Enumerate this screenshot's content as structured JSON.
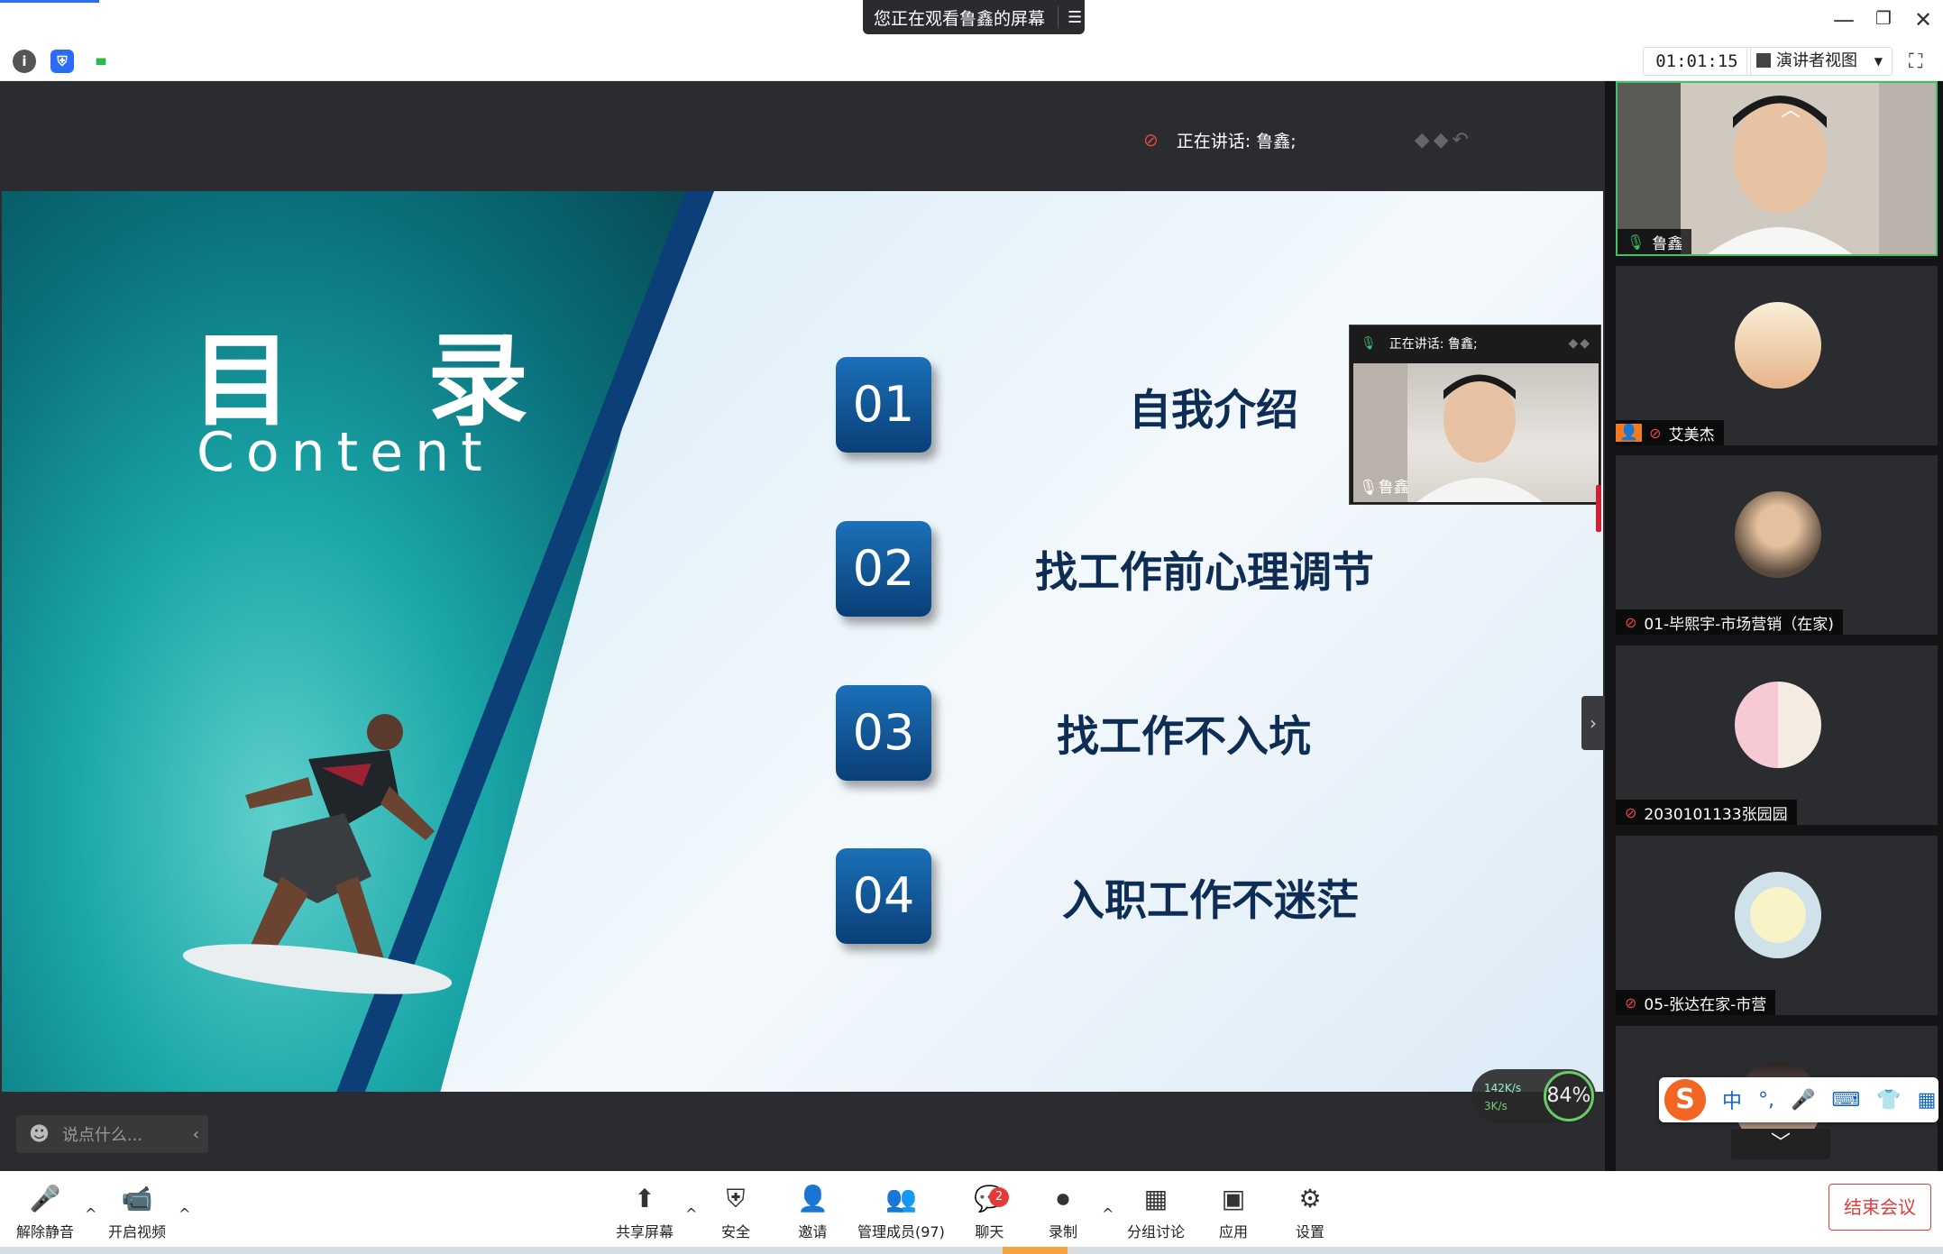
{
  "titlebar": {
    "share_banner": "您正在观看鲁鑫的屏幕",
    "minimize": "—",
    "restore": "❐",
    "close": "✕"
  },
  "toolbar": {
    "timer": "01:01:15",
    "view_mode": "演讲者视图",
    "info_icon": "i",
    "shield_icon": "⛨",
    "signal_icon": "▮▮▮"
  },
  "stage": {
    "speaker_label": "正在讲话: 鲁鑫;",
    "mic_icon": "⊘",
    "arrows": "◆◆↶"
  },
  "slide": {
    "title": "目录",
    "subtitle": "Content",
    "items": [
      {
        "num": "01",
        "text": "自我介绍"
      },
      {
        "num": "02",
        "text": "找工作前心理调节"
      },
      {
        "num": "03",
        "text": "找工作不入坑"
      },
      {
        "num": "04",
        "text": "入职工作不迷茫"
      }
    ]
  },
  "chat_input": {
    "placeholder": "说点什么..."
  },
  "pip": {
    "speaking": "正在讲话: 鲁鑫;",
    "name": "鲁鑫"
  },
  "network": {
    "up": "142K/s",
    "down": "3K/s",
    "quality": "84%"
  },
  "participants": [
    {
      "name": "鲁鑫"
    },
    {
      "name": "艾美杰"
    },
    {
      "name": "01-毕熙宇-市场营销（在家)"
    },
    {
      "name": "2030101133张园园"
    },
    {
      "name": "05-张达在家-市营"
    }
  ],
  "ime": {
    "items": [
      "中",
      "°,",
      "🎤",
      "⌨",
      "👕",
      "▦"
    ]
  },
  "bottombar": {
    "mute": "解除静音",
    "video": "开启视频",
    "share": "共享屏幕",
    "security": "安全",
    "invite": "邀请",
    "members": "管理成员(97)",
    "chat": "聊天",
    "chat_badge": "2",
    "record": "录制",
    "breakout": "分组讨论",
    "apps": "应用",
    "settings": "设置",
    "end": "结束会议"
  }
}
